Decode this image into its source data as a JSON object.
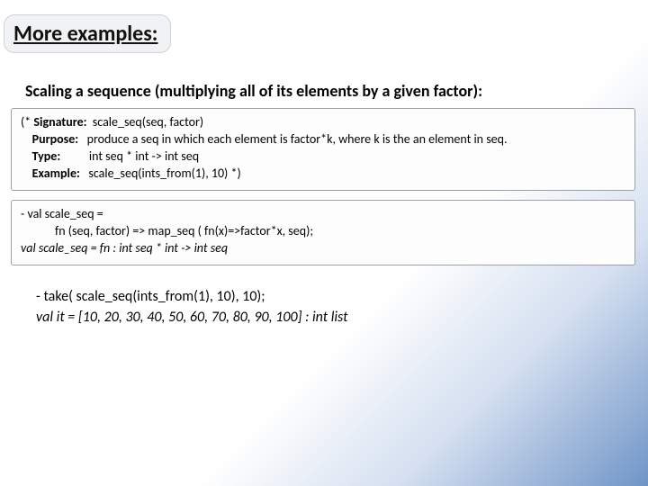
{
  "title": "More examples:",
  "subtitle": "Scaling a sequence (multiplying all of its elements by a given factor):",
  "spec": {
    "open": "(* ",
    "sig_label": "Signature: ",
    "sig_val": " scale_seq(seq, factor)",
    "indent": "    ",
    "purpose_label": "Purpose: ",
    "purpose_val": "  produce a seq in which each element is factor*k, where k is the an element in seq.",
    "type_label": "Type: ",
    "type_val": "         int seq * int -> int seq",
    "example_label": "Example: ",
    "example_val": "  scale_seq(ints_from(1), 10) *)"
  },
  "defn": {
    "l1": "- val scale_seq =",
    "l2": "            fn (seq, factor) => map_seq ( fn(x)=>factor*x, seq);",
    "l3": "val scale_seq = fn : int seq * int -> int seq"
  },
  "run": {
    "call": "- take( scale_seq(ints_from(1), 10), 10);",
    "result": "val it = [10, 20, 30, 40, 50, 60, 70, 80, 90, 100] : int list"
  }
}
